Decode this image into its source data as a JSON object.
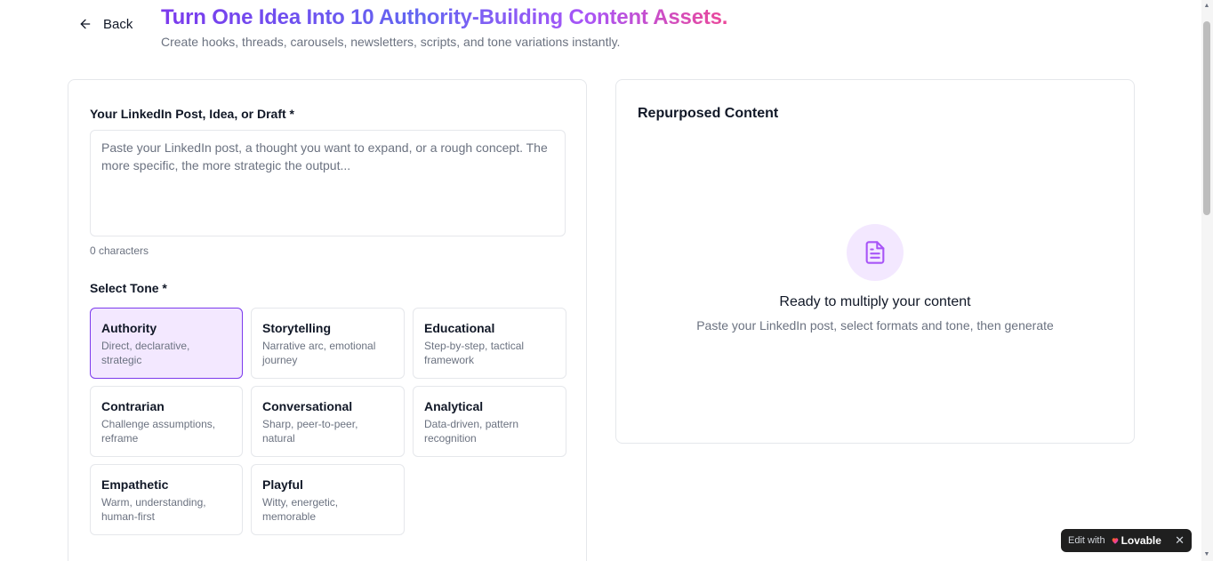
{
  "header": {
    "back_label": "Back",
    "title": "Turn One Idea Into 10 Authority-Building Content Assets.",
    "subtitle": "Create hooks, threads, carousels, newsletters, scripts, and tone variations instantly."
  },
  "form": {
    "post_label": "Your LinkedIn Post, Idea, or Draft *",
    "post_placeholder": "Paste your LinkedIn post, a thought you want to expand, or a rough concept. The more specific, the more strategic the output...",
    "char_count": "0 characters",
    "tone_label": "Select Tone *",
    "tones": [
      {
        "name": "Authority",
        "desc": "Direct, declarative, strategic",
        "selected": true
      },
      {
        "name": "Storytelling",
        "desc": "Narrative arc, emotional journey",
        "selected": false
      },
      {
        "name": "Educational",
        "desc": "Step-by-step, tactical framework",
        "selected": false
      },
      {
        "name": "Contrarian",
        "desc": "Challenge assumptions, reframe",
        "selected": false
      },
      {
        "name": "Conversational",
        "desc": "Sharp, peer-to-peer, natural",
        "selected": false
      },
      {
        "name": "Analytical",
        "desc": "Data-driven, pattern recognition",
        "selected": false
      },
      {
        "name": "Empathetic",
        "desc": "Warm, understanding, human-first",
        "selected": false
      },
      {
        "name": "Playful",
        "desc": "Witty, energetic, memorable",
        "selected": false
      }
    ]
  },
  "output": {
    "title": "Repurposed Content",
    "empty_title": "Ready to multiply your content",
    "empty_subtitle": "Paste your LinkedIn post, select formats and tone, then generate"
  },
  "badge": {
    "edit_label": "Edit with",
    "brand": "Lovable",
    "close": "✕"
  },
  "colors": {
    "accent": "#7c3aed",
    "selected_bg": "#f3e8ff",
    "badge_bg": "#1f1f1f"
  }
}
